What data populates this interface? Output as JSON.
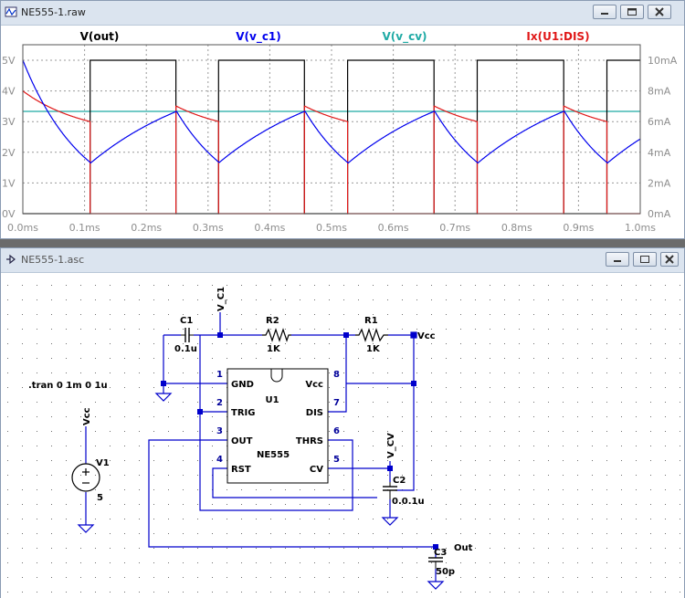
{
  "waveform_window": {
    "title": "NE555-1.raw",
    "traces": [
      {
        "name": "V(out)",
        "color": "#000000"
      },
      {
        "name": "V(v_c1)",
        "color": "#0000ee"
      },
      {
        "name": "V(v_cv)",
        "color": "#1faaa5"
      },
      {
        "name": "Ix(U1:DIS)",
        "color": "#e01818"
      }
    ],
    "left_axis_labels": [
      "5V",
      "4V",
      "3V",
      "2V",
      "1V",
      "0V"
    ],
    "right_axis_labels": [
      "10mA",
      "8mA",
      "6mA",
      "4mA",
      "2mA",
      "0mA"
    ],
    "x_axis_labels": [
      "0.0ms",
      "0.1ms",
      "0.2ms",
      "0.3ms",
      "0.4ms",
      "0.5ms",
      "0.6ms",
      "0.7ms",
      "0.8ms",
      "0.9ms",
      "1.0ms"
    ],
    "colors": {
      "grid": "#9a9a9a",
      "plot_bg": "#ffffff"
    }
  },
  "schematic_window": {
    "title": "NE555-1.asc",
    "directive": ".tran 0 1m 0 1u",
    "ic": {
      "ref": "U1",
      "part": "NE555",
      "pins_left": [
        {
          "num": "1",
          "name": "GND"
        },
        {
          "num": "2",
          "name": "TRIG"
        },
        {
          "num": "3",
          "name": "OUT"
        },
        {
          "num": "4",
          "name": "RST"
        }
      ],
      "pins_right": [
        {
          "num": "8",
          "name": "Vcc"
        },
        {
          "num": "7",
          "name": "DIS"
        },
        {
          "num": "6",
          "name": "THRS"
        },
        {
          "num": "5",
          "name": "CV"
        }
      ]
    },
    "components": {
      "c1": {
        "ref": "C1",
        "value": "0.1u"
      },
      "r2": {
        "ref": "R2",
        "value": "1K"
      },
      "r1": {
        "ref": "R1",
        "value": "1K"
      },
      "c2": {
        "ref": "C2",
        "value": "0.0.1u"
      },
      "c3": {
        "ref": "C3",
        "value": "50p"
      },
      "v1": {
        "ref": "V1",
        "value": "5"
      }
    },
    "net_labels": {
      "v_c1": "V_C1",
      "vcc_r1": "Vcc",
      "vcc_v1": "Vcc",
      "v_cv": "V_CV",
      "out": "Out"
    },
    "colors": {
      "wire": "#0000cc",
      "component": "#000000",
      "pin_number": "#00009a",
      "dot_grid": "#7a7a7a"
    }
  }
}
